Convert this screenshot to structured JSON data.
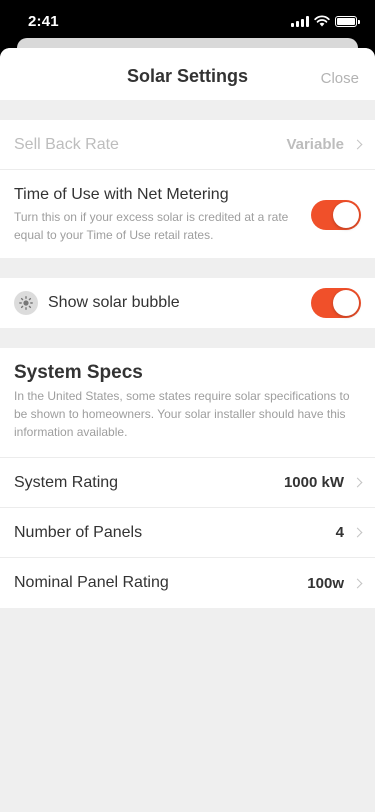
{
  "status_bar": {
    "time": "2:41"
  },
  "header": {
    "title": "Solar Settings",
    "close_label": "Close"
  },
  "rows": {
    "sell_back": {
      "label": "Sell Back Rate",
      "value": "Variable"
    },
    "time_of_use": {
      "title": "Time of Use with Net Metering",
      "description": "Turn this on if your excess solar is credited at a rate equal to your Time of Use retail rates.",
      "enabled": true
    },
    "solar_bubble": {
      "label": "Show solar bubble",
      "enabled": true
    }
  },
  "system_specs": {
    "title": "System Specs",
    "description": "In the United States, some states require solar specifications to be shown to homeowners. Your solar installer should have this information available.",
    "items": [
      {
        "label": "System Rating",
        "value": "1000 kW"
      },
      {
        "label": "Number of Panels",
        "value": "4"
      },
      {
        "label": "Nominal Panel Rating",
        "value": "100w"
      }
    ]
  },
  "colors": {
    "accent": "#f0502a",
    "background": "#efefef",
    "text": "#333333",
    "muted": "#9e9e9e"
  },
  "icons": [
    "signal-icon",
    "wifi-icon",
    "battery-icon",
    "sun-icon",
    "chevron-right-icon"
  ]
}
